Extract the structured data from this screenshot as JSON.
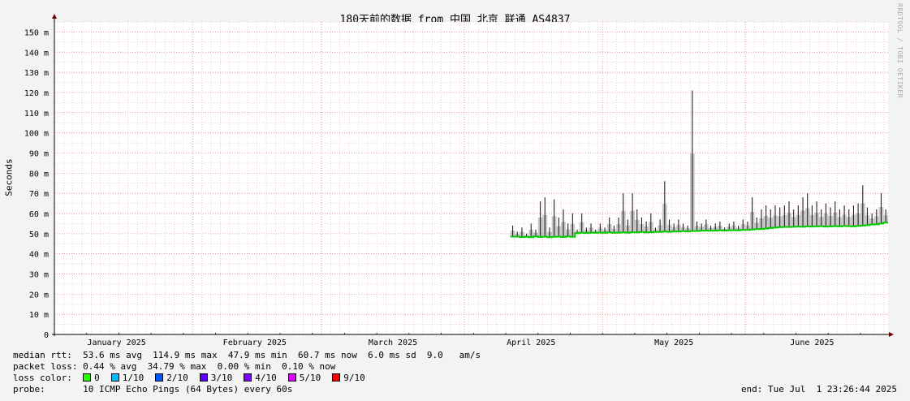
{
  "title": "180天前的数据 from 中国 北京 联通 AS4837",
  "watermark": "RRDTOOL / TOBI OETIKER",
  "chart_data": {
    "type": "area",
    "ylabel": "Seconds",
    "ylim": [
      0,
      155
    ],
    "yticks": [
      {
        "v": 0,
        "label": "0"
      },
      {
        "v": 10,
        "label": "10 m"
      },
      {
        "v": 20,
        "label": "20 m"
      },
      {
        "v": 30,
        "label": "30 m"
      },
      {
        "v": 40,
        "label": "40 m"
      },
      {
        "v": 50,
        "label": "50 m"
      },
      {
        "v": 60,
        "label": "60 m"
      },
      {
        "v": 70,
        "label": "70 m"
      },
      {
        "v": 80,
        "label": "80 m"
      },
      {
        "v": 90,
        "label": "90 m"
      },
      {
        "v": 100,
        "label": "100 m"
      },
      {
        "v": 110,
        "label": "110 m"
      },
      {
        "v": 120,
        "label": "120 m"
      },
      {
        "v": 130,
        "label": "130 m"
      },
      {
        "v": 140,
        "label": "140 m"
      },
      {
        "v": 150,
        "label": "150 m"
      }
    ],
    "xrange": [
      "2025-01-02",
      "2025-07-01"
    ],
    "month_ticks": [
      {
        "date": "2025-01-01",
        "label": ""
      },
      {
        "date": "2025-01-15",
        "label": "January 2025"
      },
      {
        "date": "2025-02-01",
        "label": ""
      },
      {
        "date": "2025-02-14",
        "label": "February 2025"
      },
      {
        "date": "2025-03-01",
        "label": ""
      },
      {
        "date": "2025-03-16",
        "label": "March 2025"
      },
      {
        "date": "2025-04-01",
        "label": ""
      },
      {
        "date": "2025-04-15",
        "label": "April 2025"
      },
      {
        "date": "2025-05-01",
        "label": ""
      },
      {
        "date": "2025-05-16",
        "label": "May 2025"
      },
      {
        "date": "2025-06-01",
        "label": ""
      },
      {
        "date": "2025-06-15",
        "label": "June 2025"
      }
    ],
    "series": [
      {
        "points": [
          {
            "date": "2025-04-11",
            "median": 48.5,
            "high": 54
          },
          {
            "date": "2025-04-12",
            "median": 48.5,
            "high": 51
          },
          {
            "date": "2025-04-13",
            "median": 48.3,
            "high": 53
          },
          {
            "date": "2025-04-14",
            "median": 48.4,
            "high": 50
          },
          {
            "date": "2025-04-15",
            "median": 48.2,
            "high": 55
          },
          {
            "date": "2025-04-16",
            "median": 48.6,
            "high": 52
          },
          {
            "date": "2025-04-17",
            "median": 48.3,
            "high": 66
          },
          {
            "date": "2025-04-18",
            "median": 48.5,
            "high": 68
          },
          {
            "date": "2025-04-19",
            "median": 48.2,
            "high": 53
          },
          {
            "date": "2025-04-20",
            "median": 48.4,
            "high": 67
          },
          {
            "date": "2025-04-21",
            "median": 48.5,
            "high": 58
          },
          {
            "date": "2025-04-22",
            "median": 48.3,
            "high": 62
          },
          {
            "date": "2025-04-23",
            "median": 48.6,
            "high": 55
          },
          {
            "date": "2025-04-24",
            "median": 48.4,
            "high": 60
          },
          {
            "date": "2025-04-25",
            "median": 50.2,
            "high": 52
          },
          {
            "date": "2025-04-26",
            "median": 50.4,
            "high": 60
          },
          {
            "date": "2025-04-27",
            "median": 50.3,
            "high": 53
          },
          {
            "date": "2025-04-28",
            "median": 50.5,
            "high": 55
          },
          {
            "date": "2025-04-29",
            "median": 50.4,
            "high": 52
          },
          {
            "date": "2025-04-30",
            "median": 50.5,
            "high": 55
          },
          {
            "date": "2025-05-01",
            "median": 50.4,
            "high": 53
          },
          {
            "date": "2025-05-02",
            "median": 50.6,
            "high": 58
          },
          {
            "date": "2025-05-03",
            "median": 50.4,
            "high": 54
          },
          {
            "date": "2025-05-04",
            "median": 50.5,
            "high": 58
          },
          {
            "date": "2025-05-05",
            "median": 50.6,
            "high": 70
          },
          {
            "date": "2025-05-06",
            "median": 50.5,
            "high": 57
          },
          {
            "date": "2025-05-07",
            "median": 50.7,
            "high": 70
          },
          {
            "date": "2025-05-08",
            "median": 50.6,
            "high": 62
          },
          {
            "date": "2025-05-09",
            "median": 50.8,
            "high": 58
          },
          {
            "date": "2025-05-10",
            "median": 50.6,
            "high": 56
          },
          {
            "date": "2025-05-11",
            "median": 50.7,
            "high": 60
          },
          {
            "date": "2025-05-12",
            "median": 50.9,
            "high": 53
          },
          {
            "date": "2025-05-13",
            "median": 50.8,
            "high": 57
          },
          {
            "date": "2025-05-14",
            "median": 51.0,
            "high": 76
          },
          {
            "date": "2025-05-15",
            "median": 50.9,
            "high": 57
          },
          {
            "date": "2025-05-16",
            "median": 51.1,
            "high": 55
          },
          {
            "date": "2025-05-17",
            "median": 51.0,
            "high": 57
          },
          {
            "date": "2025-05-18",
            "median": 51.2,
            "high": 55
          },
          {
            "date": "2025-05-19",
            "median": 51.1,
            "high": 54
          },
          {
            "date": "2025-05-20",
            "median": 51.3,
            "high": 121
          },
          {
            "date": "2025-05-21",
            "median": 51.3,
            "high": 56
          },
          {
            "date": "2025-05-22",
            "median": 51.4,
            "high": 55
          },
          {
            "date": "2025-05-23",
            "median": 51.5,
            "high": 57
          },
          {
            "date": "2025-05-24",
            "median": 51.4,
            "high": 54
          },
          {
            "date": "2025-05-25",
            "median": 51.5,
            "high": 55
          },
          {
            "date": "2025-05-26",
            "median": 51.6,
            "high": 56
          },
          {
            "date": "2025-05-27",
            "median": 51.5,
            "high": 53
          },
          {
            "date": "2025-05-28",
            "median": 51.6,
            "high": 55
          },
          {
            "date": "2025-05-29",
            "median": 51.7,
            "high": 56
          },
          {
            "date": "2025-05-30",
            "median": 51.6,
            "high": 54
          },
          {
            "date": "2025-05-31",
            "median": 51.8,
            "high": 57
          },
          {
            "date": "2025-06-01",
            "median": 51.8,
            "high": 56
          },
          {
            "date": "2025-06-02",
            "median": 52.0,
            "high": 68
          },
          {
            "date": "2025-06-03",
            "median": 52.2,
            "high": 58
          },
          {
            "date": "2025-06-04",
            "median": 52.3,
            "high": 62
          },
          {
            "date": "2025-06-05",
            "median": 52.5,
            "high": 64
          },
          {
            "date": "2025-06-06",
            "median": 52.8,
            "high": 62
          },
          {
            "date": "2025-06-07",
            "median": 53.0,
            "high": 64
          },
          {
            "date": "2025-06-08",
            "median": 53.2,
            "high": 63
          },
          {
            "date": "2025-06-09",
            "median": 53.3,
            "high": 64
          },
          {
            "date": "2025-06-10",
            "median": 53.3,
            "high": 66
          },
          {
            "date": "2025-06-11",
            "median": 53.4,
            "high": 62
          },
          {
            "date": "2025-06-12",
            "median": 53.5,
            "high": 64
          },
          {
            "date": "2025-06-13",
            "median": 53.4,
            "high": 68
          },
          {
            "date": "2025-06-14",
            "median": 53.6,
            "high": 70
          },
          {
            "date": "2025-06-15",
            "median": 53.5,
            "high": 64
          },
          {
            "date": "2025-06-16",
            "median": 53.6,
            "high": 66
          },
          {
            "date": "2025-06-17",
            "median": 53.7,
            "high": 62
          },
          {
            "date": "2025-06-18",
            "median": 53.5,
            "high": 65
          },
          {
            "date": "2025-06-19",
            "median": 53.6,
            "high": 63
          },
          {
            "date": "2025-06-20",
            "median": 53.7,
            "high": 66
          },
          {
            "date": "2025-06-21",
            "median": 53.6,
            "high": 62
          },
          {
            "date": "2025-06-22",
            "median": 53.8,
            "high": 64
          },
          {
            "date": "2025-06-23",
            "median": 53.7,
            "high": 62
          },
          {
            "date": "2025-06-24",
            "median": 53.6,
            "high": 64
          },
          {
            "date": "2025-06-25",
            "median": 53.8,
            "high": 65
          },
          {
            "date": "2025-06-26",
            "median": 54.0,
            "high": 74
          },
          {
            "date": "2025-06-27",
            "median": 54.2,
            "high": 63
          },
          {
            "date": "2025-06-28",
            "median": 54.5,
            "high": 60
          },
          {
            "date": "2025-06-29",
            "median": 54.6,
            "high": 62
          },
          {
            "date": "2025-06-30",
            "median": 55.0,
            "high": 70
          },
          {
            "date": "2025-07-01",
            "median": 55.5,
            "high": 62
          }
        ]
      }
    ],
    "colors": {
      "median": "#00cc00",
      "smoke": "#9a9a9a",
      "grid_minor": "#e8b0b0",
      "grid_major": "#e07070",
      "axis": "#7a0000"
    }
  },
  "legend": {
    "median_rtt": "median rtt:  53.6 ms avg  114.9 ms max  47.9 ms min  60.7 ms now  6.0 ms sd  9.0   am/s",
    "packet_loss": "packet loss: 0.44 % avg  34.79 % max  0.00 % min  0.10 % now",
    "loss_color_label": "loss color:",
    "loss_colors": [
      {
        "label": "0",
        "color": "#26ff00"
      },
      {
        "label": "1/10",
        "color": "#00b8ff"
      },
      {
        "label": "2/10",
        "color": "#0059ff"
      },
      {
        "label": "3/10",
        "color": "#5e00ff"
      },
      {
        "label": "4/10",
        "color": "#7e00ff"
      },
      {
        "label": "5/10",
        "color": "#dd00ff"
      },
      {
        "label": "9/10",
        "color": "#ff0000"
      }
    ],
    "probe": "probe:       10 ICMP Echo Pings (64 Bytes) every 60s",
    "end": "end: Tue Jul  1 23:26:44 2025"
  }
}
